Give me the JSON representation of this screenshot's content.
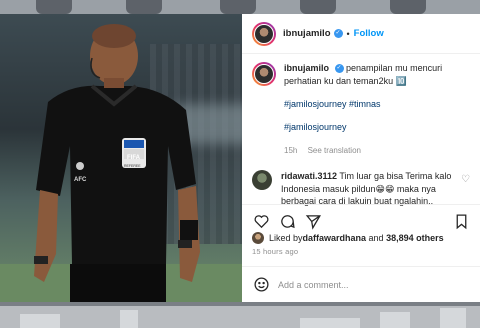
{
  "post": {
    "username": "ibnujamilo",
    "verified_icon": "verified-badge-icon",
    "follow_label": "Follow",
    "dot": "•",
    "caption": "penampilan mu mencuri perhatian ku dan teman2ku 🔟",
    "hashtags_1": "#jamilosjourney #timnas",
    "hashtags_2": "#jamilosjourney",
    "caption_age": "15h",
    "see_translation": "See translation",
    "comment": {
      "username": "ridawati.3112",
      "text": "Tim luar ga bisa Terima kalo Indonesia masuk pildun😁😁 maka nya berbagai cara di lakuin buat ngalahin.."
    },
    "likes_prefix": "Liked by ",
    "likes_user": "daffawardhana",
    "likes_and": " and ",
    "likes_count": "38,894 others",
    "posted_ago": "15 hours ago",
    "add_comment_placeholder": "Add a comment..."
  },
  "icons": [
    "heart-icon",
    "comment-icon",
    "share-icon",
    "save-icon",
    "emoji-icon"
  ],
  "photo": {
    "badge_text": "FIFA",
    "badge_sub": "REFEREE",
    "sleeve_text": "AFC"
  },
  "colors": {
    "accent": "#0095f6",
    "text": "#262626",
    "muted": "#8e8e8e",
    "shirt": "#111111"
  }
}
